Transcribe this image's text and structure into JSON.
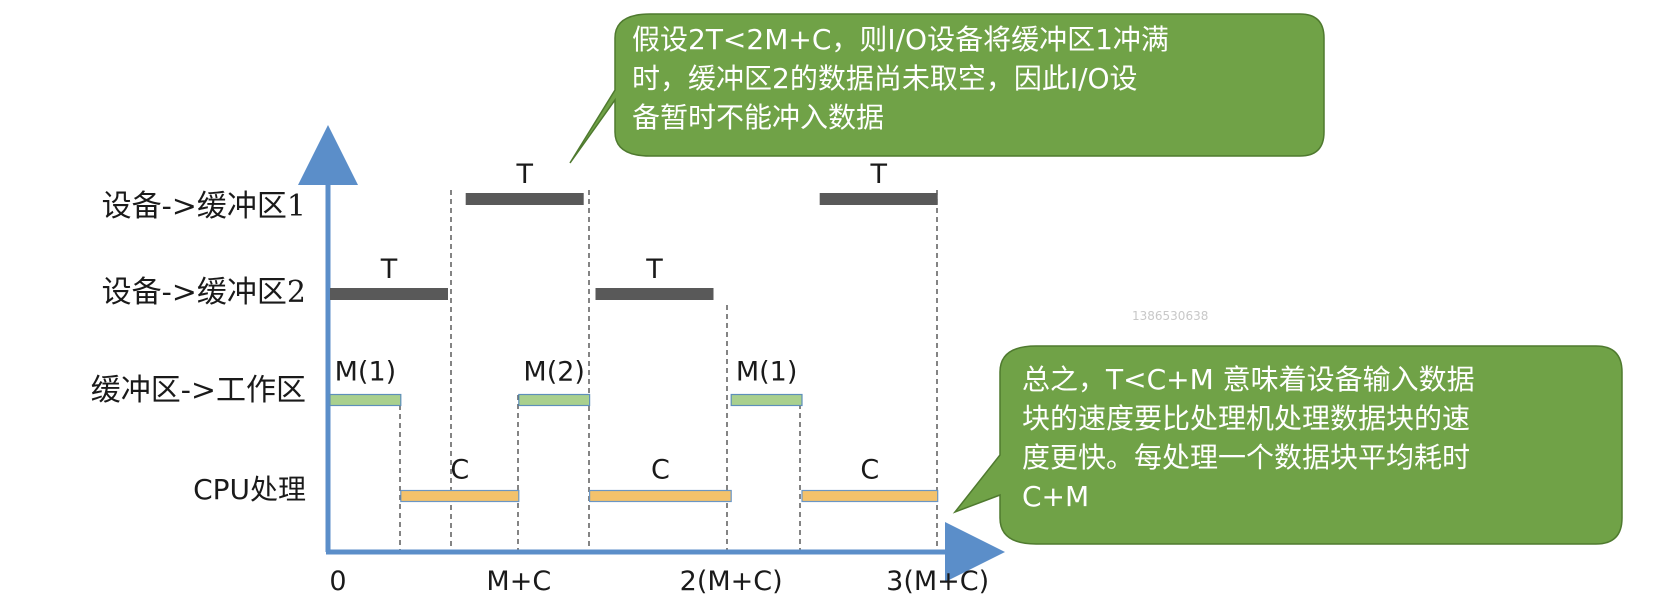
{
  "rows": [
    "设备->缓冲区1",
    "设备->缓冲区2",
    "缓冲区->工作区",
    "CPU处理"
  ],
  "bars": [
    {
      "row": 0,
      "start": 1.15,
      "end": 2.15,
      "label": "T",
      "color": "#595959"
    },
    {
      "row": 0,
      "start": 4.15,
      "end": 5.15,
      "label": "T",
      "color": "#595959"
    },
    {
      "row": 1,
      "start": 0.0,
      "end": 1.0,
      "label": "T",
      "color": "#595959"
    },
    {
      "row": 1,
      "start": 2.25,
      "end": 3.25,
      "label": "T",
      "color": "#595959"
    },
    {
      "row": 2,
      "start": 0.0,
      "end": 0.6,
      "label": "M(1)",
      "color": "#a9d08e"
    },
    {
      "row": 2,
      "start": 1.6,
      "end": 2.2,
      "label": "M(2)",
      "color": "#a9d08e"
    },
    {
      "row": 2,
      "start": 3.4,
      "end": 4.0,
      "label": "M(1)",
      "color": "#a9d08e"
    },
    {
      "row": 3,
      "start": 0.6,
      "end": 1.6,
      "label": "C",
      "color": "#f4c26b"
    },
    {
      "row": 3,
      "start": 2.2,
      "end": 3.4,
      "label": "C",
      "color": "#f4c26b"
    },
    {
      "row": 3,
      "start": 4.0,
      "end": 5.15,
      "label": "C",
      "color": "#f4c26b"
    }
  ],
  "ticks": [
    {
      "label": "0",
      "at": 0.0
    },
    {
      "label": "M+C",
      "at": 1.6
    },
    {
      "label": "2(M+C)",
      "at": 3.4
    },
    {
      "label": "3(M+C)",
      "at": 5.15
    }
  ],
  "axis_color": "#5b8ec9",
  "callout_fill": "#70a247",
  "callout1": {
    "lines": [
      "假设2T<2M+C，则I/O设备将缓冲区1冲满",
      "时，缓冲区2的数据尚未取空，因此I/O设",
      "备暂时不能冲入数据"
    ]
  },
  "callout2": {
    "lines": [
      "总之，T<C+M 意味着设备输入数据",
      "块的速度要比处理机处理数据块的速",
      "度更快。每处理一个数据块平均耗时",
      "C+M"
    ]
  },
  "watermark": "1386530638"
}
